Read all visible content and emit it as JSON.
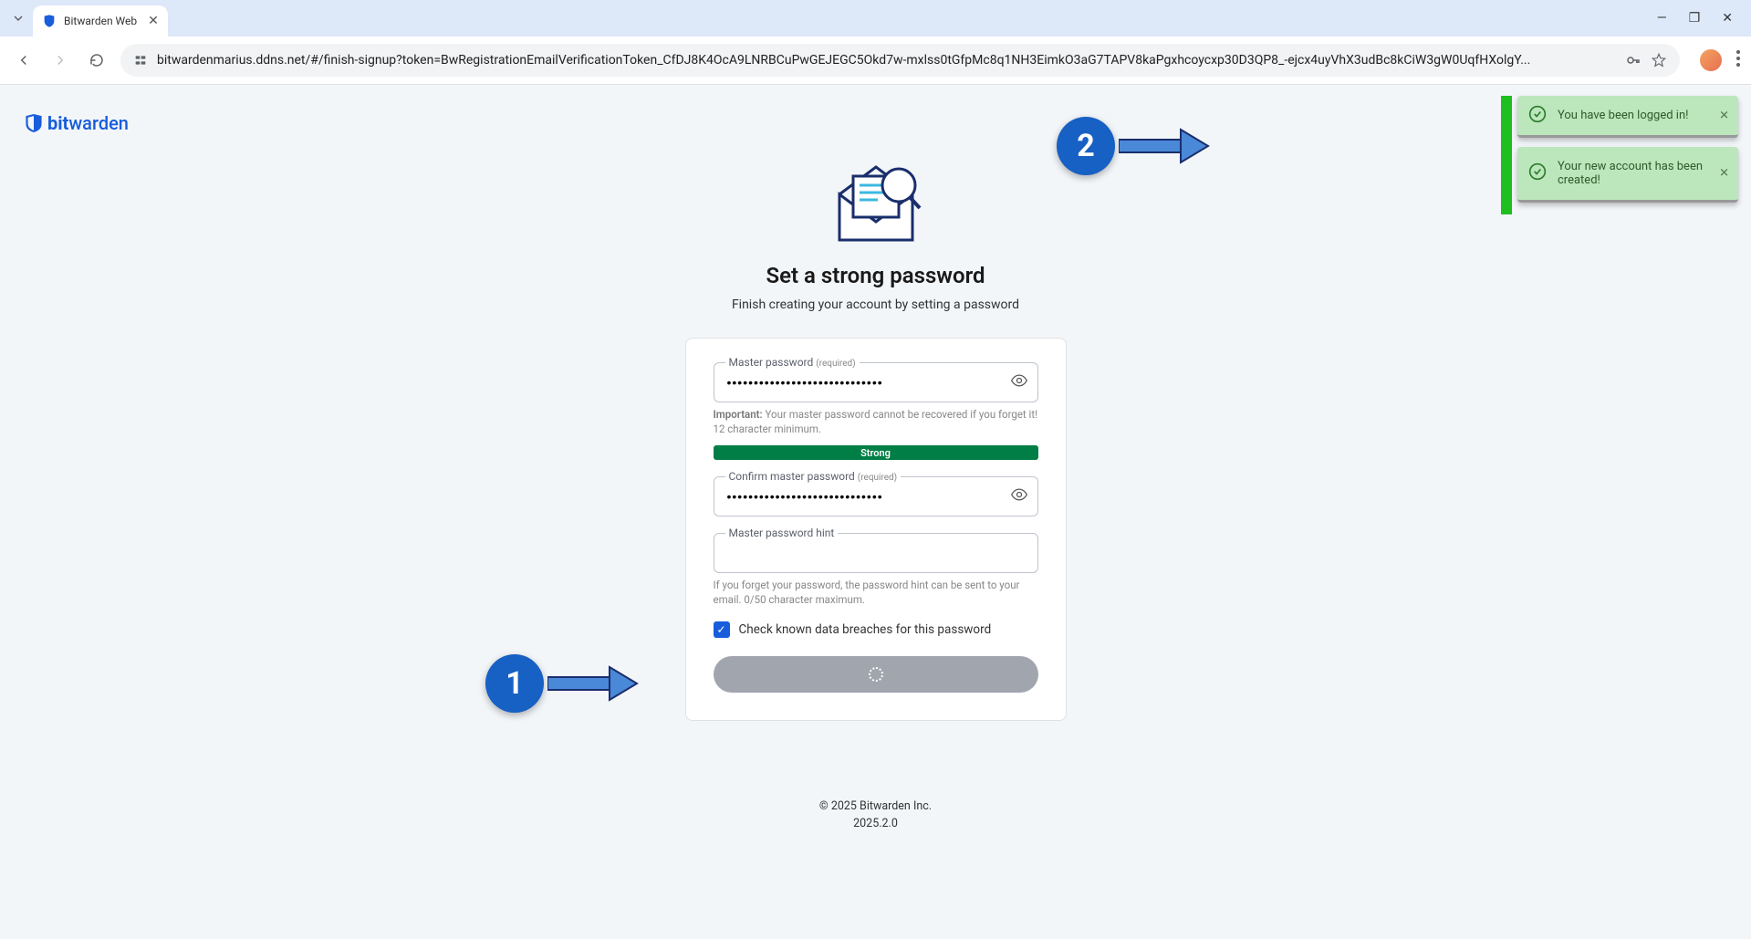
{
  "browser": {
    "tab_title": "Bitwarden Web",
    "url": "bitwardenmarius.ddns.net/#/finish-signup?token=BwRegistrationEmailVerificationToken_CfDJ8K4OcA9LNRBCuPwGEJEGC5Okd7w-mxlss0tGfpMc8q1NH3EimkO3aG7TAPV8kaPgxhcoycxp30D3QP8_-ejcx4uyVhX3udBc8kCiW3gW0UqfHXolgY..."
  },
  "brand": {
    "name_bold": "bit",
    "name_rest": "warden"
  },
  "heading": "Set a strong password",
  "subtitle": "Finish creating your account by setting a password",
  "fields": {
    "master": {
      "label": "Master password",
      "required": "(required)",
      "value": "•••••••••••••••••••••••••••••",
      "hint_bold": "Important:",
      "hint_rest": " Your master password cannot be recovered if you forget it! 12 character minimum."
    },
    "strength": "Strong",
    "confirm": {
      "label": "Confirm master password",
      "required": "(required)",
      "value": "•••••••••••••••••••••••••••••"
    },
    "hint": {
      "label": "Master password hint",
      "value": "",
      "help": "If you forget your password, the password hint can be sent to your email. 0/50 character maximum."
    }
  },
  "checkbox_label": "Check known data breaches for this password",
  "footer": {
    "copyright": "© 2025 Bitwarden Inc.",
    "version": "2025.2.0"
  },
  "toasts": {
    "t1": "You have been logged in!",
    "t2": "Your new account has been created!"
  },
  "annotations": {
    "one": "1",
    "two": "2"
  }
}
